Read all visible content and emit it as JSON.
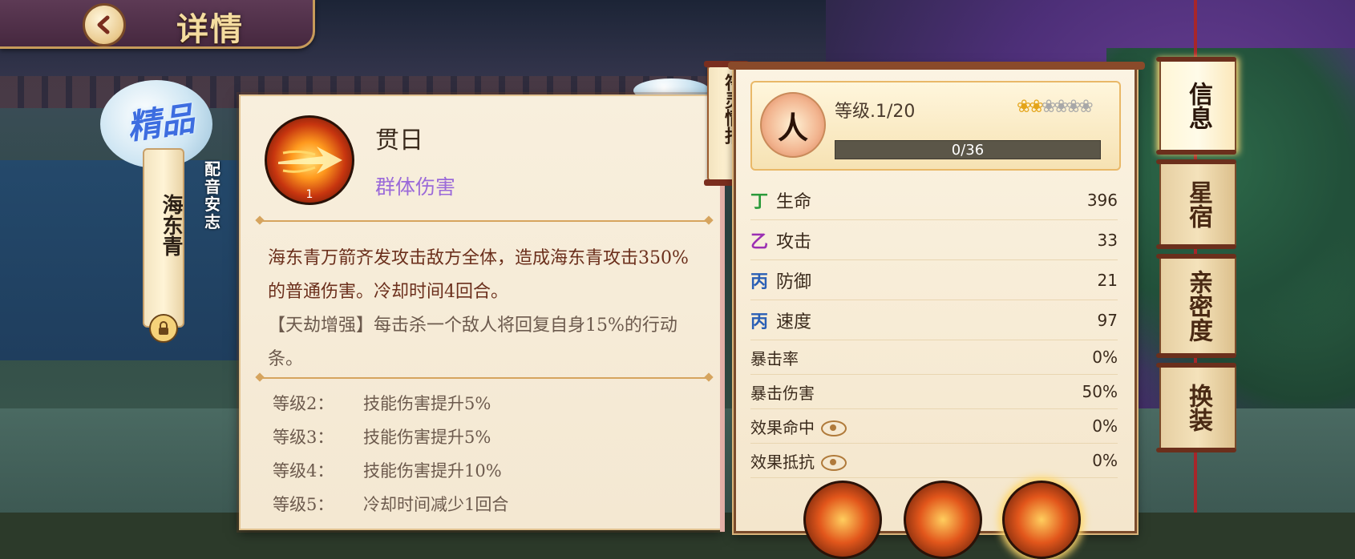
{
  "header": {
    "title": "详情",
    "back_icon": "back-arrow-icon"
  },
  "character": {
    "rarity": "精品",
    "name": "海东青",
    "voice_label": "配音",
    "voice_actor": "安志"
  },
  "skill": {
    "name": "贯日",
    "type": "群体伤害",
    "icon_level": "1",
    "description": "海东青万箭齐发攻击敌方全体，造成海东青攻击350%的普通伤害。冷却时间4回合。",
    "enhance": "【天劫增强】每击杀一个敌人将回复自身15%的行动条。",
    "levels": [
      {
        "level": "等级2：",
        "effect": "技能伤害提升5%"
      },
      {
        "level": "等级3：",
        "effect": "技能伤害提升5%"
      },
      {
        "level": "等级4：",
        "effect": "技能伤害提升10%"
      },
      {
        "level": "等级5：",
        "effect": "冷却时间减少1回合"
      }
    ]
  },
  "panel": {
    "tag_label": "符灵情报",
    "level_icon_text": "人",
    "level_label": "等级.1/20",
    "stars_filled": 2,
    "stars_total": 6,
    "xp_text": "0/36",
    "xp_fraction": 0,
    "stats": [
      {
        "icon": "丁",
        "icon_color": "#2a9a3a",
        "label": "生命",
        "value": "396"
      },
      {
        "icon": "乙",
        "icon_color": "#9b2fb3",
        "label": "攻击",
        "value": "33"
      },
      {
        "icon": "丙",
        "icon_color": "#2a5fb5",
        "label": "防御",
        "value": "21"
      },
      {
        "icon": "丙",
        "icon_color": "#2a5fb5",
        "label": "速度",
        "value": "97"
      }
    ],
    "sub_stats": [
      {
        "label": "暴击率",
        "value": "0%"
      },
      {
        "label": "暴击伤害",
        "value": "50%"
      },
      {
        "label": "效果命中",
        "value": "0%"
      },
      {
        "label": "效果抵抗",
        "value": "0%"
      }
    ]
  },
  "tabs": [
    {
      "label": "信息",
      "active": true
    },
    {
      "label": "星宿",
      "active": false
    },
    {
      "label": "亲密度",
      "active": false
    },
    {
      "label": "换装",
      "active": false
    }
  ],
  "colors": {
    "accent": "#e6b04a",
    "header_bg": "#5d3a55",
    "desc_red": "#6b2f1c",
    "skill_type": "#9b6ad9"
  }
}
